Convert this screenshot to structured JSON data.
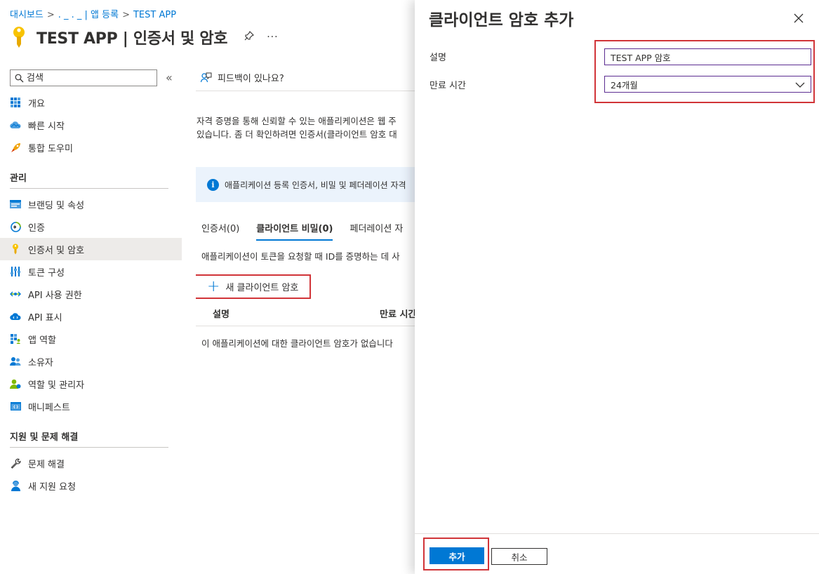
{
  "breadcrumb": {
    "home": "대시보드",
    "middle": ". _ . _ | 앱 등록",
    "current": "TEST APP",
    "separator": ">"
  },
  "header": {
    "title": "TEST APP | 인증서 및 암호",
    "pin_icon": "pin-icon",
    "more": "···"
  },
  "sidebar": {
    "search_placeholder": "검색",
    "collapse": "«",
    "top_items": [
      {
        "label": "개요",
        "icon": "grid-icon"
      },
      {
        "label": "빠른 시작",
        "icon": "cloud-icon"
      },
      {
        "label": "통합 도우미",
        "icon": "rocket-icon"
      }
    ],
    "section_manage": "관리",
    "manage_items": [
      {
        "label": "브랜딩 및 속성",
        "icon": "branding-icon"
      },
      {
        "label": "인증",
        "icon": "auth-icon"
      },
      {
        "label": "인증서 및 암호",
        "icon": "key-icon",
        "active": true
      },
      {
        "label": "토큰 구성",
        "icon": "token-icon"
      },
      {
        "label": "API 사용 권한",
        "icon": "api-permission-icon"
      },
      {
        "label": "API 표시",
        "icon": "api-cloud-icon"
      },
      {
        "label": "앱 역할",
        "icon": "app-roles-icon"
      },
      {
        "label": "소유자",
        "icon": "owners-icon"
      },
      {
        "label": "역할 및 관리자",
        "icon": "roles-admin-icon"
      },
      {
        "label": "매니페스트",
        "icon": "manifest-icon"
      }
    ],
    "section_support": "지원 및 문제 해결",
    "support_items": [
      {
        "label": "문제 해결",
        "icon": "wrench-icon"
      },
      {
        "label": "새 지원 요청",
        "icon": "support-person-icon"
      }
    ]
  },
  "main": {
    "feedback": "피드백이 있나요?",
    "description_line1": "자격 증명을 통해 신뢰할 수 있는 애플리케이션은 웹 주",
    "description_line2": "있습니다. 좀 더 확인하려면 인증서(클라이언트 암호 대",
    "info_text": "애플리케이션 등록 인증서, 비밀 및 페더레이션 자격",
    "tabs": [
      {
        "label": "인증서(0)",
        "selected": false
      },
      {
        "label": "클라이언트 비밀(0)",
        "selected": true
      },
      {
        "label": "페더레이션 자",
        "selected": false
      }
    ],
    "tab_description": "애플리케이션이 토큰을 요청할 때 ID를 증명하는 데 사",
    "new_secret_label": "새 클라이언트 암호",
    "table_headers": [
      "설명",
      "만료 시간"
    ],
    "empty_message": "이 애플리케이션에 대한 클라이언트 암호가 없습니다"
  },
  "panel": {
    "title": "클라이언트 암호 추가",
    "close": "✕",
    "description_label": "설명",
    "description_value": "TEST APP 암호",
    "expiry_label": "만료 시간",
    "expiry_value": "24개월",
    "add_button": "추가",
    "cancel_button": "취소"
  },
  "colors": {
    "accent": "#0078d4",
    "highlight_box": "#d13438",
    "input_border": "#5c2d91",
    "info_background": "#ebf3fc"
  }
}
